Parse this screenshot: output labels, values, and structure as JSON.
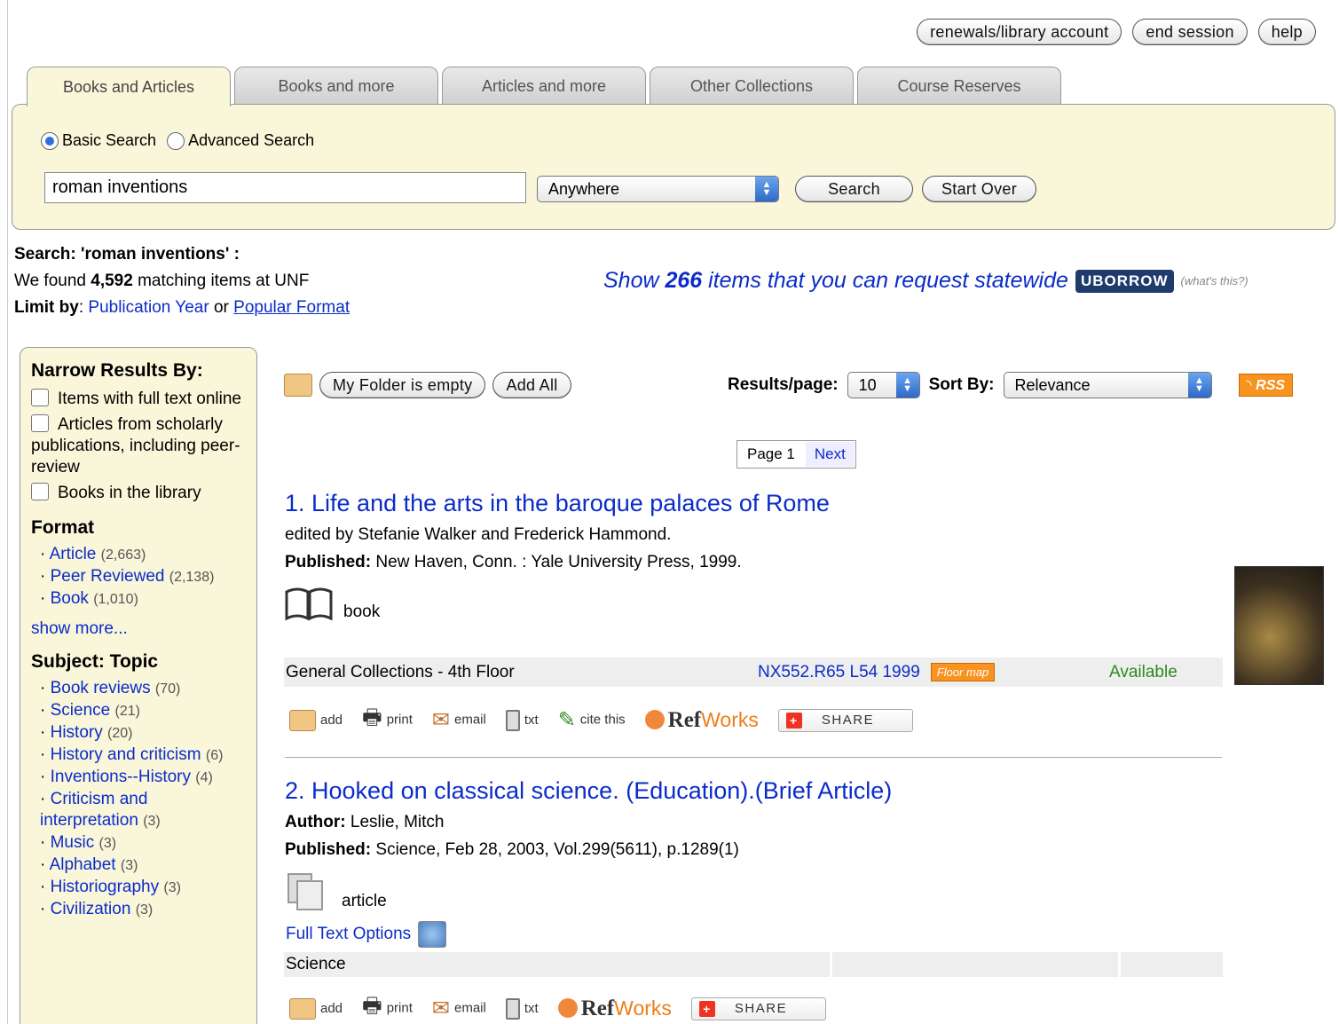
{
  "top_buttons": {
    "account": "renewals/library account",
    "end": "end session",
    "help": "help"
  },
  "tabs": [
    "Books and Articles",
    "Books and more",
    "Articles and more",
    "Other Collections",
    "Course Reserves"
  ],
  "search": {
    "basic_label": "Basic Search",
    "advanced_label": "Advanced Search",
    "query": "roman inventions",
    "field": "Anywhere",
    "search_btn": "Search",
    "start_over_btn": "Start Over"
  },
  "summary": {
    "search_label": "Search: 'roman inventions' :",
    "found_pre": "We found ",
    "count": "4,592",
    "found_post": " matching items at UNF",
    "limit_label": "Limit by",
    "pub_year": "Publication Year",
    "or": "or",
    "popular_format": "Popular Format"
  },
  "uborrow": {
    "show": "Show ",
    "count": "266",
    "rest": " items that you can request statewide",
    "logo": "UBORROW",
    "whats": "(what's this?)"
  },
  "sidebar": {
    "narrow_title": "Narrow Results By:",
    "checks": [
      "Items with full text online",
      "Articles from scholarly publications, including peer-review",
      "Books in the library"
    ],
    "format_title": "Format",
    "formats": [
      {
        "label": "Article",
        "count": "(2,663)"
      },
      {
        "label": "Peer Reviewed",
        "count": "(2,138)"
      },
      {
        "label": "Book",
        "count": "(1,010)"
      }
    ],
    "show_more": "show more...",
    "subject_title": "Subject: Topic",
    "subjects": [
      {
        "label": "Book reviews",
        "count": "(70)"
      },
      {
        "label": "Science",
        "count": "(21)"
      },
      {
        "label": "History",
        "count": "(20)"
      },
      {
        "label": "History and criticism",
        "count": "(6)"
      },
      {
        "label": "Inventions--History",
        "count": "(4)"
      },
      {
        "label": "Criticism and interpretation",
        "count": "(3)"
      },
      {
        "label": "Music",
        "count": "(3)"
      },
      {
        "label": "Alphabet",
        "count": "(3)"
      },
      {
        "label": "Historiography",
        "count": "(3)"
      },
      {
        "label": "Civilization",
        "count": "(3)"
      }
    ]
  },
  "toolbar": {
    "folder": "My Folder is empty",
    "add_all": "Add All",
    "results_label": "Results/page:",
    "results_value": "10",
    "sort_label": "Sort By:",
    "sort_value": "Relevance",
    "rss": "RSS"
  },
  "pager": {
    "page": "Page 1",
    "next": "Next"
  },
  "results": [
    {
      "title": "1. Life and the arts in the baroque palaces of Rome",
      "line1": "edited by Stefanie Walker and Frederick Hammond.",
      "pub_label": "Published:",
      "pub": " New Haven, Conn. : Yale University Press, 1999.",
      "type": "book",
      "location": "General Collections - 4th Floor",
      "callno": "NX552.R65 L54 1999",
      "floor_map": "Floor map",
      "status": "Available"
    },
    {
      "title": "2. Hooked on classical science. (Education).(Brief Article)",
      "author_label": "Author:",
      "author": " Leslie, Mitch",
      "pub_label": "Published:",
      "pub": " Science, Feb 28, 2003, Vol.299(5611), p.1289(1)",
      "type": "article",
      "full_text": "Full Text Options",
      "source": "Science"
    }
  ],
  "actions": {
    "add": "add",
    "print": "print",
    "email": "email",
    "txt": "txt",
    "cite": "cite this",
    "ref": "Ref",
    "works": "Works",
    "share": "SHARE"
  }
}
